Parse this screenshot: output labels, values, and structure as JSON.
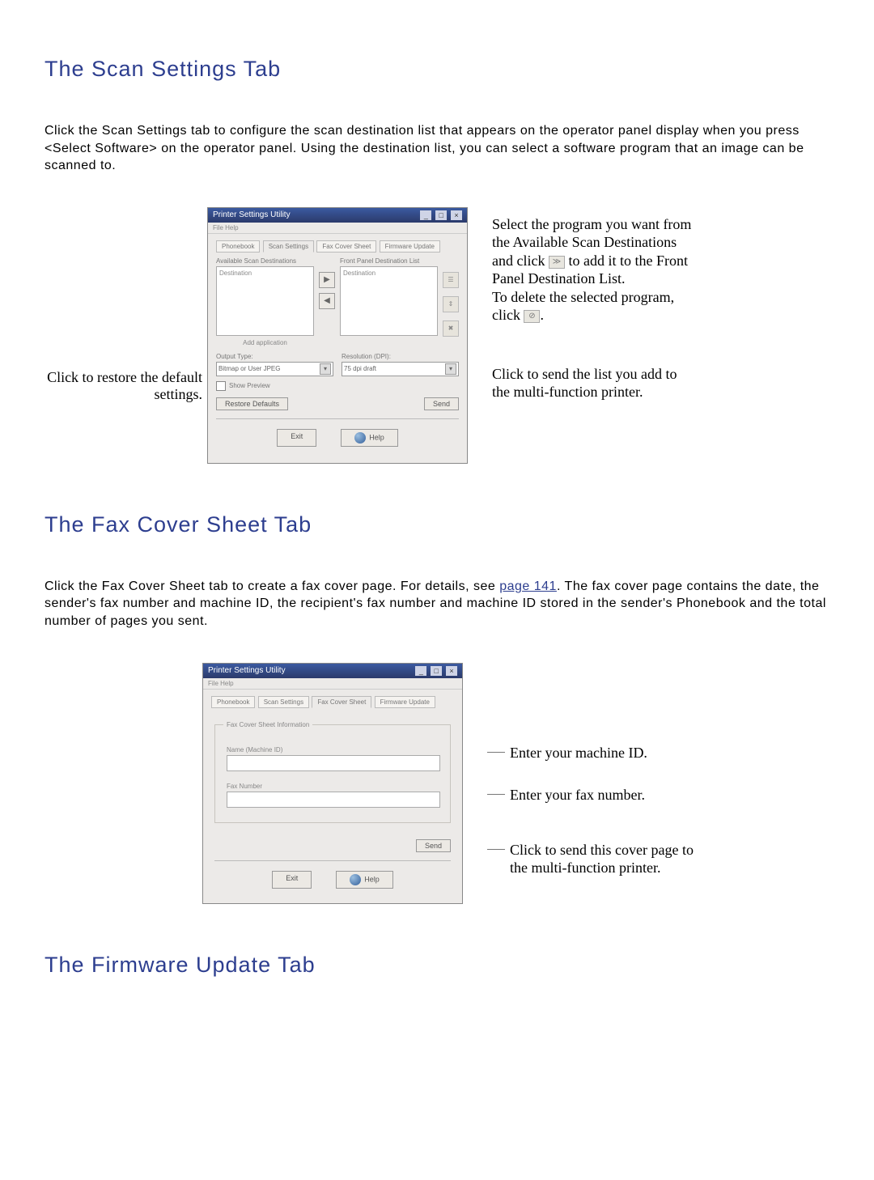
{
  "sections": {
    "scan": {
      "heading": "The Scan Settings Tab",
      "paragraph": "Click the Scan Settings tab to configure the scan destination list that appears on the operator panel display when you press <Select Software> on the operator panel. Using the destination list, you can select a software program that an image can be scanned to."
    },
    "fax": {
      "heading": "The Fax Cover Sheet Tab",
      "paragraph_pre": "Click the Fax Cover Sheet tab to create a fax cover page. For details, see ",
      "paragraph_link": "page 141",
      "paragraph_post": ". The fax cover page contains the date, the sender's fax number and machine ID, the recipient's fax number and machine ID stored in the sender's Phonebook and the total number of pages you sent."
    },
    "firmware": {
      "heading": "The Firmware Update Tab"
    }
  },
  "scan_window": {
    "title": "Printer Settings Utility",
    "menu": "File  Help",
    "tabs": [
      "Phonebook",
      "Scan Settings",
      "Fax Cover Sheet",
      "Firmware Update"
    ],
    "left_list_label": "Available Scan Destinations",
    "right_list_label": "Front Panel Destination List",
    "placeholder_item": "Destination",
    "move_icon": "Move",
    "output_type_label": "Output Type:",
    "output_type_value": "Bitmap or User JPEG",
    "resolution_label": "Resolution (DPI):",
    "resolution_value": "75 dpi draft",
    "show_preview": "Show Preview",
    "restore_btn": "Restore Defaults",
    "send_btn": "Send",
    "exit_btn": "Exit",
    "help_btn": "Help"
  },
  "scan_callouts": {
    "left": "Click to restore the default settings.",
    "right_top": "Select the program you want from the Available Scan Destinations and click      to add it to the Front Panel Destination List.\nTo delete the selected program, click     .",
    "right_add_icon": "≫",
    "right_del_icon": "⊘",
    "right_bottom": "Click to send the list you add to the multi-function printer."
  },
  "fax_window": {
    "title": "Printer Settings Utility",
    "menu": "File  Help",
    "tabs": [
      "Phonebook",
      "Scan Settings",
      "Fax Cover Sheet",
      "Firmware Update"
    ],
    "group_title": "Fax Cover Sheet Information",
    "machine_id_label": "Name (Machine ID)",
    "fax_number_label": "Fax Number",
    "send_btn": "Send",
    "exit_btn": "Exit",
    "help_btn": "Help"
  },
  "fax_callouts": {
    "machine_id": "Enter your machine ID.",
    "fax_number": "Enter your fax number.",
    "send": "Click to send this cover page to the multi-function printer."
  }
}
